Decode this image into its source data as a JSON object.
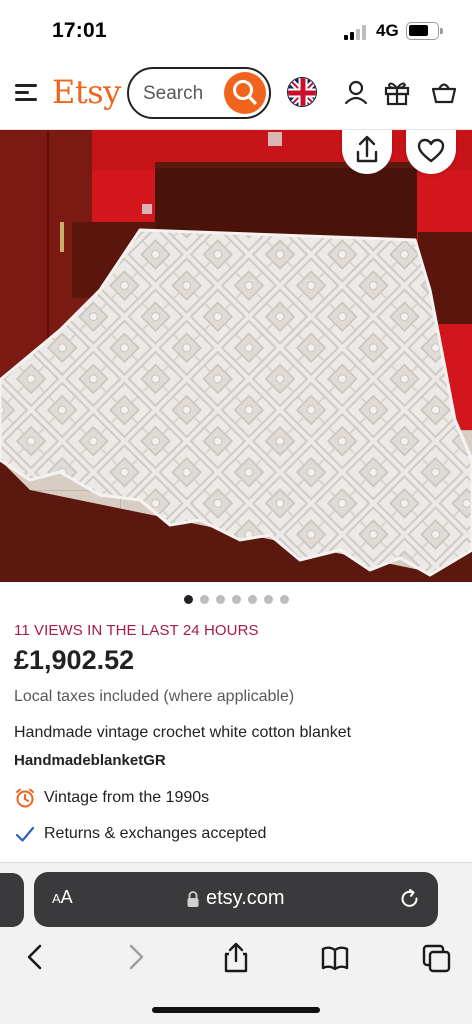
{
  "status_bar": {
    "time": "17:01",
    "network": "4G"
  },
  "header": {
    "logo": "Etsy",
    "search_placeholder": "Search",
    "brand_color": "#f1641e",
    "icons": [
      "menu-icon",
      "search-icon",
      "uk-flag-icon",
      "account-icon",
      "gift-icon",
      "basket-icon"
    ]
  },
  "gallery": {
    "image_count": 7,
    "active_index": 0,
    "actions": [
      "share-icon",
      "heart-icon"
    ]
  },
  "listing": {
    "views": "11 VIEWS IN THE LAST 24 HOURS",
    "price": "£1,902.52",
    "tax_note": "Local taxes included (where applicable)",
    "title": "Handmade vintage crochet white cotton blanket",
    "shop": "HandmadeblanketGR",
    "features": [
      {
        "icon": "clock-icon",
        "text": "Vintage from the 1990s"
      },
      {
        "icon": "check-icon",
        "text": "Returns & exchanges accepted"
      }
    ]
  },
  "browser": {
    "aa_label_large": "A",
    "aa_label_small": "A",
    "url": "etsy.com",
    "toolbar": [
      "back-icon",
      "forward-icon",
      "share-icon",
      "bookmarks-icon",
      "tabs-icon"
    ]
  }
}
